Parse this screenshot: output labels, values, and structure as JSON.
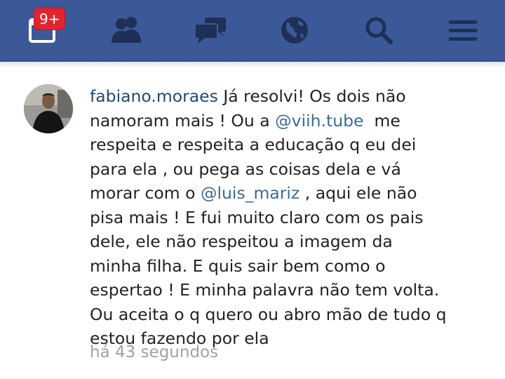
{
  "nav": {
    "notifications_badge": "9+",
    "items": [
      {
        "icon": "notifications-icon"
      },
      {
        "icon": "friends-icon"
      },
      {
        "icon": "messages-icon"
      },
      {
        "icon": "globe-icon"
      },
      {
        "icon": "search-icon"
      },
      {
        "icon": "menu-icon"
      }
    ]
  },
  "comment": {
    "username": "fabiano.moraes",
    "lines": [
      "Já resolvi! Os dois não",
      "namoram mais ! Ou a",
      "@viih.tube",
      "me",
      "respeita e respeita a educação q eu dei",
      "para ela , ou pega as coisas dela e vá",
      "morar com o",
      "@luis_mariz",
      ", aqui ele não",
      "pisa mais ! E fui muito claro com os pais",
      "dele, ele não respeitou a imagem da",
      "minha filha. E quis sair bem como o",
      "espertao ! E minha palavra não tem volta.",
      "Ou aceita o q quero ou abro mão de tudo q",
      "estou fazendo por ela"
    ],
    "timestamp": "há 43 segundos"
  },
  "colors": {
    "topbar": "#3b5998",
    "username": "#244a6b",
    "mention": "#3d6a92",
    "timestamp": "#9aa3ad",
    "badge": "#e0252e"
  }
}
